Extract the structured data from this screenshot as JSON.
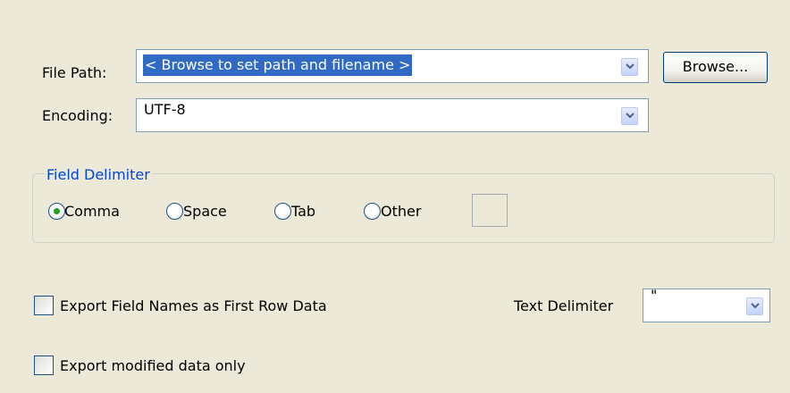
{
  "file_path": {
    "label": "File Path:",
    "value": "< Browse to set path and filename >",
    "browse_label": "Browse..."
  },
  "encoding": {
    "label": "Encoding:",
    "value": "UTF-8"
  },
  "field_delimiter": {
    "title": "Field Delimiter",
    "options": [
      "Comma",
      "Space",
      "Tab",
      "Other"
    ],
    "selected": "Comma",
    "other_value": ""
  },
  "export_field_names": {
    "label": "Export Field Names as First Row Data",
    "checked": false
  },
  "text_delimiter": {
    "label": "Text Delimiter",
    "value": "\""
  },
  "export_modified": {
    "label": "Export modified data only",
    "checked": false
  },
  "icons": {
    "dropdown": "chevron-down-icon",
    "radio_selected_color": "#21a121"
  }
}
